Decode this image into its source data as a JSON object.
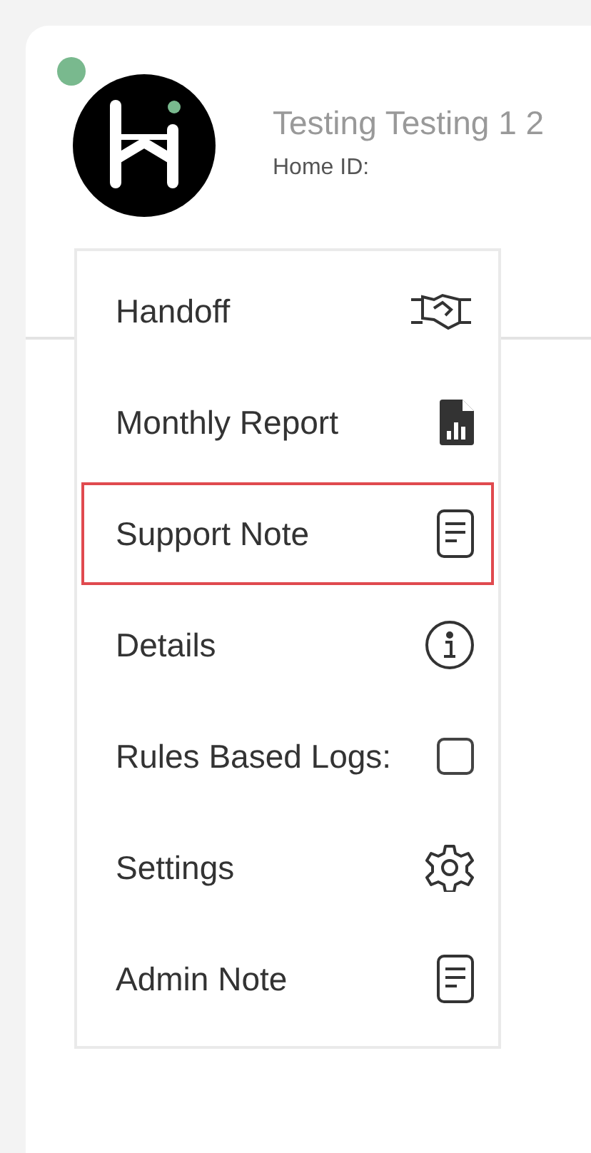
{
  "header": {
    "online": true,
    "title": "Testing Testing 1 2",
    "subtitle": "Home ID:"
  },
  "menu": {
    "items": [
      {
        "kind": "action",
        "label": "Handoff",
        "selected": false
      },
      {
        "kind": "action",
        "label": "Monthly Report",
        "selected": false
      },
      {
        "kind": "action",
        "label": "Support Note",
        "selected": true
      },
      {
        "kind": "action",
        "label": "Details",
        "selected": false
      },
      {
        "kind": "checkbox",
        "label": "Rules Based Logs:",
        "checked": false,
        "selected": false
      },
      {
        "kind": "action",
        "label": "Settings",
        "selected": false
      },
      {
        "kind": "action",
        "label": "Admin Note",
        "selected": false
      }
    ]
  }
}
